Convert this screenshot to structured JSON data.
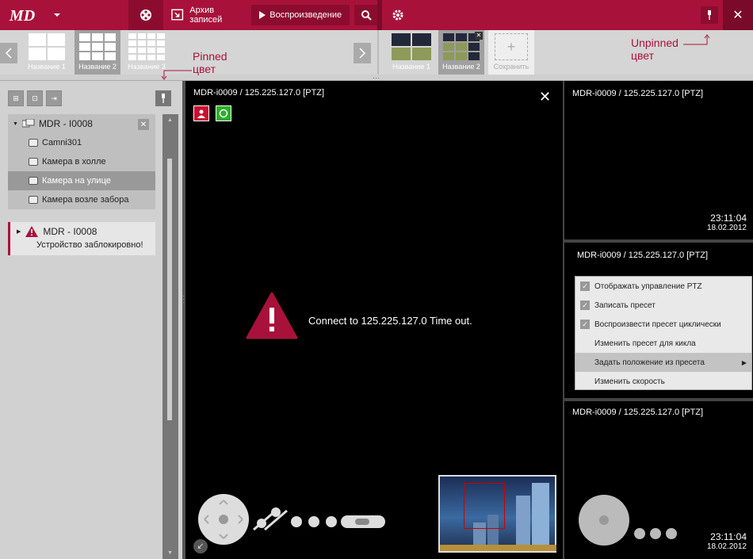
{
  "topbar": {
    "archive_label": "Архив записей",
    "play_label": "Воспроизведение",
    "close_glyph": "✕",
    "accent": "#a8123a"
  },
  "layouts": [
    {
      "label": "Название 1"
    },
    {
      "label": "Название 2"
    },
    {
      "label": "Название 3"
    }
  ],
  "custom_layouts": [
    {
      "label": "Название 1"
    },
    {
      "label": "Название 2"
    }
  ],
  "save_label": "Сохранить",
  "annotations": {
    "pinned": "Pinned",
    "pinned_2": "цвет",
    "unpinned": "Unpinned",
    "unpinned_2": "цвет"
  },
  "tree": {
    "device": "MDR - I0008",
    "cameras": [
      "Camni301",
      "Камера в холле",
      "Камера на улице",
      "Камера возле забора"
    ]
  },
  "alert": {
    "device": "MDR - I0008",
    "message": "Устройство заблокировно!"
  },
  "main_view": {
    "title": "MDR-i0009 / 125.225.127.0 [PTZ]",
    "message": "Connect to 125.225.127.0  Time out."
  },
  "side_views": [
    {
      "title": "MDR-i0009 / 125.225.127.0 [PTZ]",
      "time": "23:11:04",
      "date": "18.02.2012"
    },
    {
      "title": "MDR-i0009 / 125.225.127.0 [PTZ]"
    },
    {
      "title": "MDR-i0009 / 125.225.127.0 [PTZ]",
      "time": "23:11:04",
      "date": "18.02.2012"
    }
  ],
  "context_menu": [
    {
      "label": "Отображать управление PTZ",
      "checked": true
    },
    {
      "label": "Записать пресет",
      "checked": true
    },
    {
      "label": "Воспроизвести пресет циклически",
      "checked": true
    },
    {
      "label": "Изменить пресет для кикла",
      "checked": false
    },
    {
      "label": "Задать положение из пресета",
      "checked": false
    },
    {
      "label": "Изменить скорость",
      "checked": false
    }
  ]
}
